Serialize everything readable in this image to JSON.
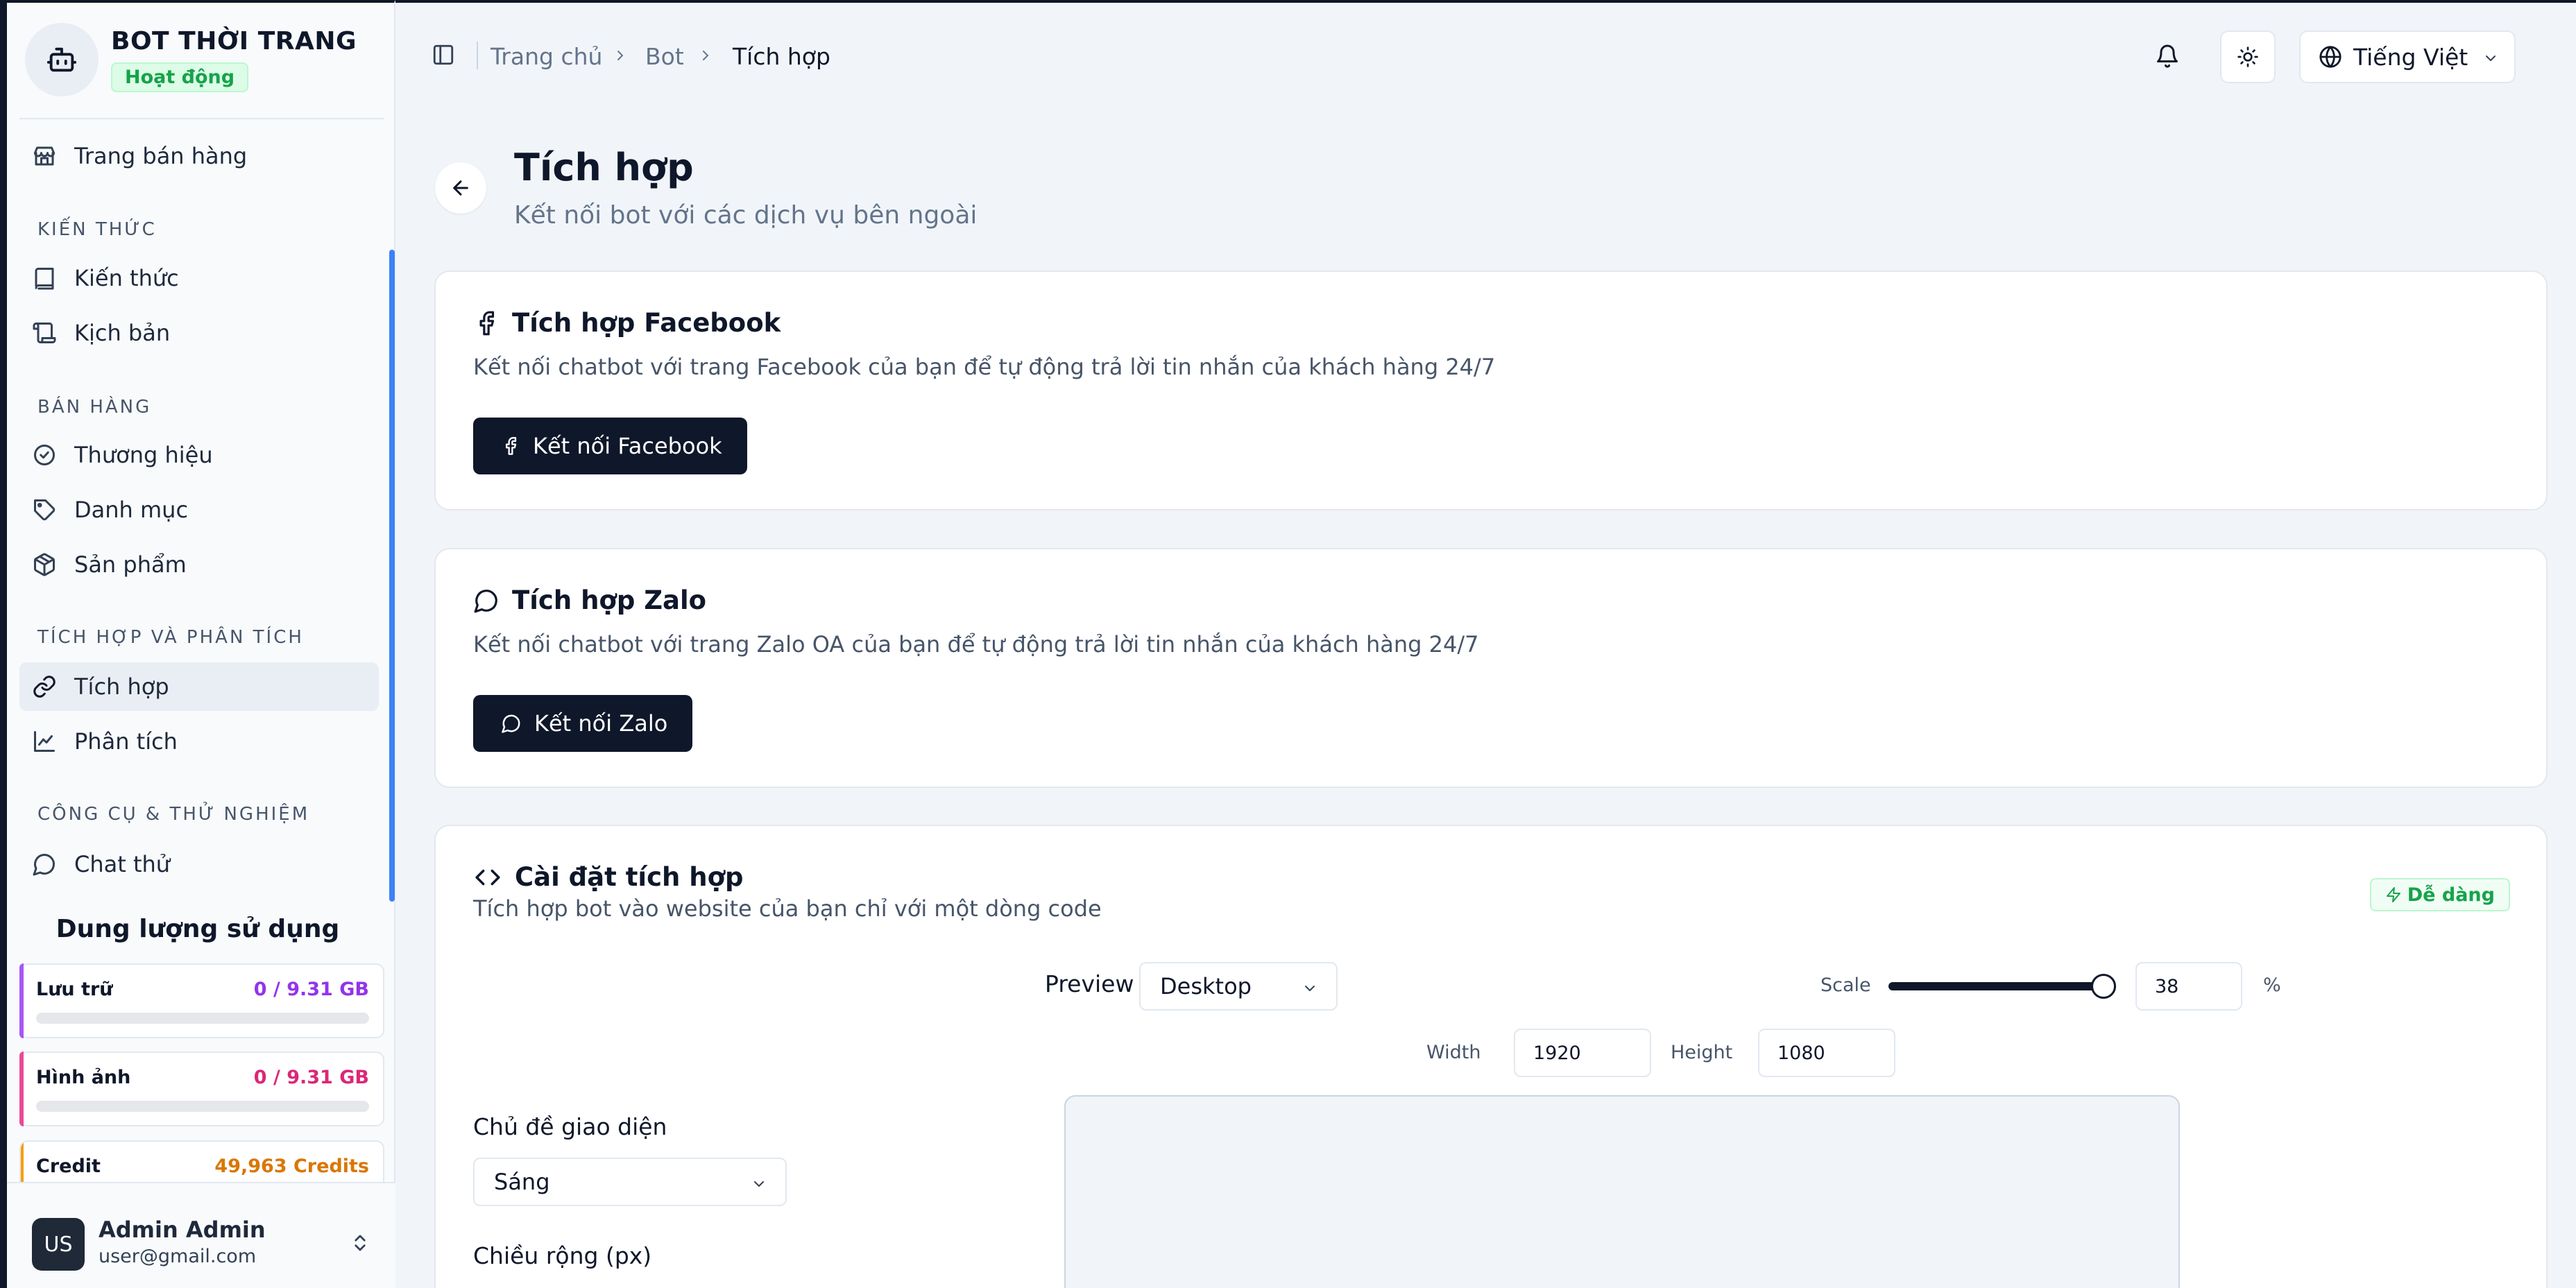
{
  "sidebar": {
    "brand_name": "BOT THỜI TRANG",
    "status": "Hoạt động",
    "shop_link": "Trang bán hàng",
    "sections": {
      "knowledge": "KIẾN THỨC",
      "sales": "BÁN HÀNG",
      "integration": "TÍCH HỢP VÀ PHÂN TÍCH",
      "tools": "CÔNG CỤ & THỬ NGHIỆM"
    },
    "items": {
      "knowledge": "Kiến thức",
      "scripts": "Kịch bản",
      "brand": "Thương hiệu",
      "category": "Danh mục",
      "products": "Sản phẩm",
      "integration": "Tích hợp",
      "analytics": "Phân tích",
      "chat_test": "Chat thử"
    },
    "usage": {
      "title": "Dung lượng sử dụng",
      "storage": {
        "label": "Lưu trữ",
        "value": "0 / 9.31 GB",
        "fraction": 0,
        "color": "#9333ea"
      },
      "images": {
        "label": "Hình ảnh",
        "value": "0 / 9.31 GB",
        "fraction": 0,
        "color": "#db2777"
      },
      "credit": {
        "label": "Credit",
        "value": "49,963 Credits",
        "color": "#d97706"
      }
    },
    "user": {
      "initials": "US",
      "name": "Admin Admin",
      "email": "user@gmail.com"
    }
  },
  "header": {
    "breadcrumb": [
      "Trang chủ",
      "Bot",
      "Tích hợp"
    ],
    "language": "Tiếng Việt"
  },
  "page": {
    "title": "Tích hợp",
    "subtitle": "Kết nối bot với các dịch vụ bên ngoài"
  },
  "facebook": {
    "title": "Tích hợp Facebook",
    "description": "Kết nối chatbot với trang Facebook của bạn để tự động trả lời tin nhắn của khách hàng 24/7",
    "button": "Kết nối Facebook"
  },
  "zalo": {
    "title": "Tích hợp Zalo",
    "description": "Kết nối chatbot với trang Zalo OA của bạn để tự động trả lời tin nhắn của khách hàng 24/7",
    "button": "Kết nối Zalo"
  },
  "embed": {
    "title": "Cài đặt tích hợp",
    "description": "Tích hợp bot vào website của bạn chỉ với một dòng code",
    "badge": "Dễ dàng",
    "preview_label": "Preview",
    "preview_device": "Desktop",
    "scale_label": "Scale",
    "scale_value": "38",
    "scale_unit": "%",
    "scale_fraction": 1.0,
    "width_label": "Width",
    "width_value": "1920",
    "height_label": "Height",
    "height_value": "1080",
    "theme_label": "Chủ đề giao diện",
    "theme_value": "Sáng",
    "width_px_label": "Chiều rộng (px)"
  },
  "colors": {
    "accent": "#3b82f6",
    "dark": "#0f172a",
    "success": "#16a34a"
  }
}
